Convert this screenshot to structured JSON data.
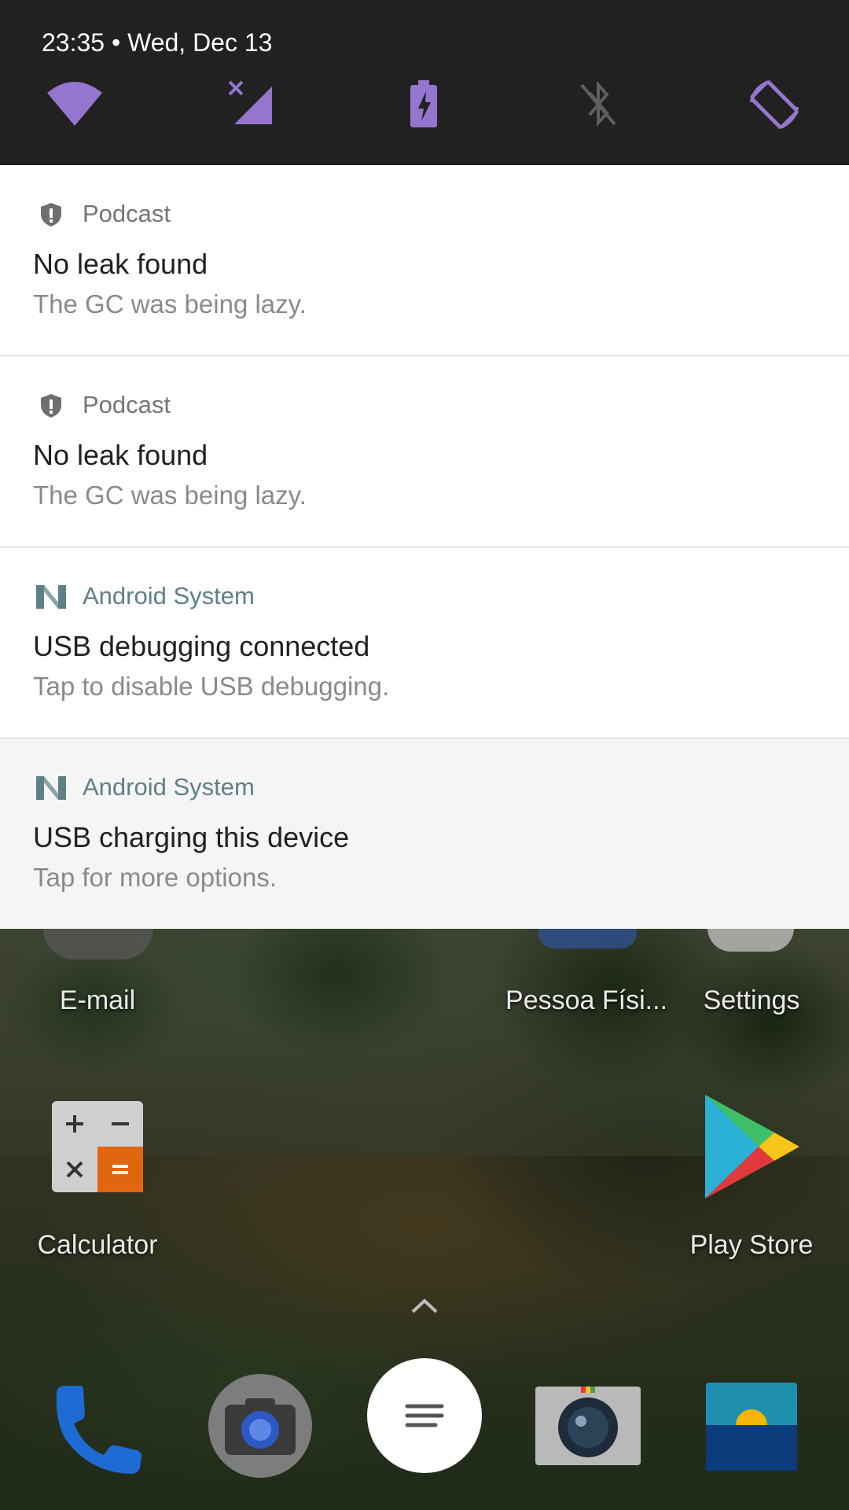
{
  "status": {
    "datetime": "23:35 • Wed, Dec 13"
  },
  "quick_settings": [
    {
      "name": "wifi-icon"
    },
    {
      "name": "cellular-no-service-icon"
    },
    {
      "name": "battery-charging-icon"
    },
    {
      "name": "bluetooth-off-icon"
    },
    {
      "name": "auto-rotate-icon"
    }
  ],
  "colors": {
    "accent": "#9575cd",
    "shade_bg": "#212121",
    "android_system_teal": "#5e8087"
  },
  "notifications": [
    {
      "app": "Podcast",
      "icon": "shield-alert-icon",
      "title": "No leak found",
      "text": "The GC was being lazy."
    },
    {
      "app": "Podcast",
      "icon": "shield-alert-icon",
      "title": "No leak found",
      "text": "The GC was being lazy."
    },
    {
      "app": "Android System",
      "icon": "android-n-icon",
      "title": "USB debugging connected",
      "text": "Tap to disable USB debugging."
    },
    {
      "app": "Android System",
      "icon": "android-n-icon",
      "title": "USB charging this device",
      "text": "Tap for more options."
    }
  ],
  "home": {
    "apps": [
      {
        "label": "E-mail"
      },
      {
        "label": "Pessoa Físi..."
      },
      {
        "label": "Settings"
      },
      {
        "label": "Calculator"
      },
      {
        "label": "Play Store"
      }
    ],
    "dock": [
      {
        "name": "phone-icon"
      },
      {
        "name": "camera-icon"
      },
      {
        "name": "google-search-icon"
      },
      {
        "name": "camera-app-icon"
      },
      {
        "name": "wallpaper-app-icon"
      }
    ]
  }
}
